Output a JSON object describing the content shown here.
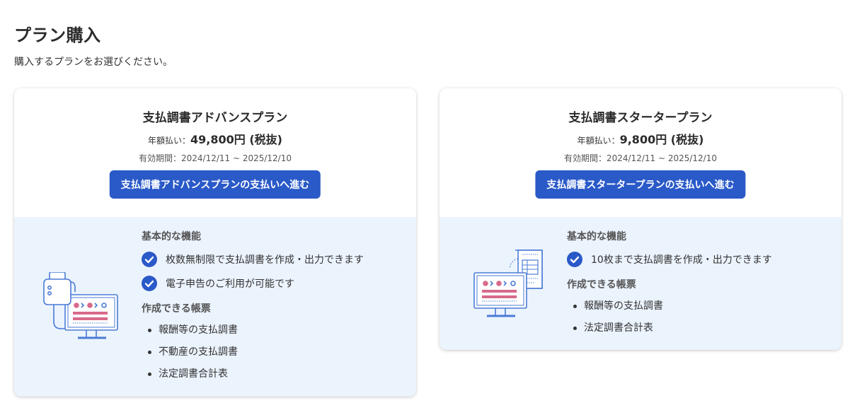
{
  "page": {
    "title": "プラン購入",
    "subtitle": "購入するプランをお選びください。"
  },
  "plans": [
    {
      "name": "支払調書アドバンスプラン",
      "price_label": "年額払い：",
      "price_value": "49,800円 (税抜)",
      "period": "有効期間：2024/12/11 ~ 2025/12/10",
      "button_label": "支払調書アドバンスプランの支払いへ進む",
      "features_heading": "基本的な機能",
      "features": [
        "枚数無制限で支払調書を作成・出力できます",
        "電子申告のご利用が可能です"
      ],
      "documents_heading": "作成できる帳票",
      "documents": [
        "報酬等の支払調書",
        "不動産の支払調書",
        "法定調書合計表"
      ],
      "illustration_icon": "computer-with-usb-key-icon"
    },
    {
      "name": "支払調書スタータープラン",
      "price_label": "年額払い：",
      "price_value": "9,800円 (税抜)",
      "period": "有効期間：2024/12/11 ~ 2025/12/10",
      "button_label": "支払調書スタータープランの支払いへ進む",
      "features_heading": "基本的な機能",
      "features": [
        "10枚まで支払調書を作成・出力できます"
      ],
      "documents_heading": "作成できる帳票",
      "documents": [
        "報酬等の支払調書",
        "法定調書合計表"
      ],
      "illustration_icon": "computer-with-document-icon"
    }
  ],
  "colors": {
    "accent": "#2a59c8",
    "card_bottom_bg": "#ebf3fd",
    "illustration_stroke": "#4a7bd6",
    "illustration_pink": "#d86a8a"
  }
}
